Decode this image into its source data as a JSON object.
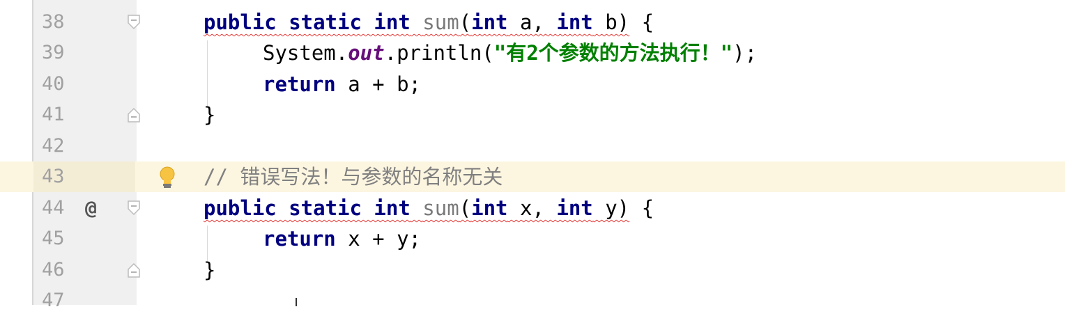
{
  "editor": {
    "lines": [
      {
        "number": "38"
      },
      {
        "number": "39"
      },
      {
        "number": "40"
      },
      {
        "number": "41"
      },
      {
        "number": "42"
      },
      {
        "number": "43"
      },
      {
        "number": "44"
      },
      {
        "number": "45"
      },
      {
        "number": "46"
      },
      {
        "number": "47"
      }
    ],
    "override_marker": "@",
    "code": {
      "l38": {
        "kw1": "public static int",
        "name": "sum",
        "p1": "(",
        "kw2": "int",
        "a": " a, ",
        "kw3": "int",
        "b": " b)",
        "brace": " {"
      },
      "l39": {
        "pre": "System.",
        "field": "out",
        "mid": ".println(",
        "str": "\"有2个参数的方法执行！\"",
        "post": ");"
      },
      "l40": {
        "kw": "return",
        "rest": " a + b;"
      },
      "l41": {
        "text": "}"
      },
      "l43": {
        "comment": "// 错误写法！与参数的名称无关"
      },
      "l44": {
        "kw1": "public static int",
        "name": "sum",
        "p1": "(",
        "kw2": "int",
        "x": " x, ",
        "kw3": "int",
        "y": " y)",
        "brace": " {"
      },
      "l45": {
        "kw": "return",
        "rest": " x + y;"
      },
      "l46": {
        "text": "}"
      }
    }
  },
  "colors": {
    "keyword": "#000080",
    "string": "#008000",
    "comment": "#808080",
    "current_line": "#fcf5e0",
    "error_underline": "#e53935"
  }
}
